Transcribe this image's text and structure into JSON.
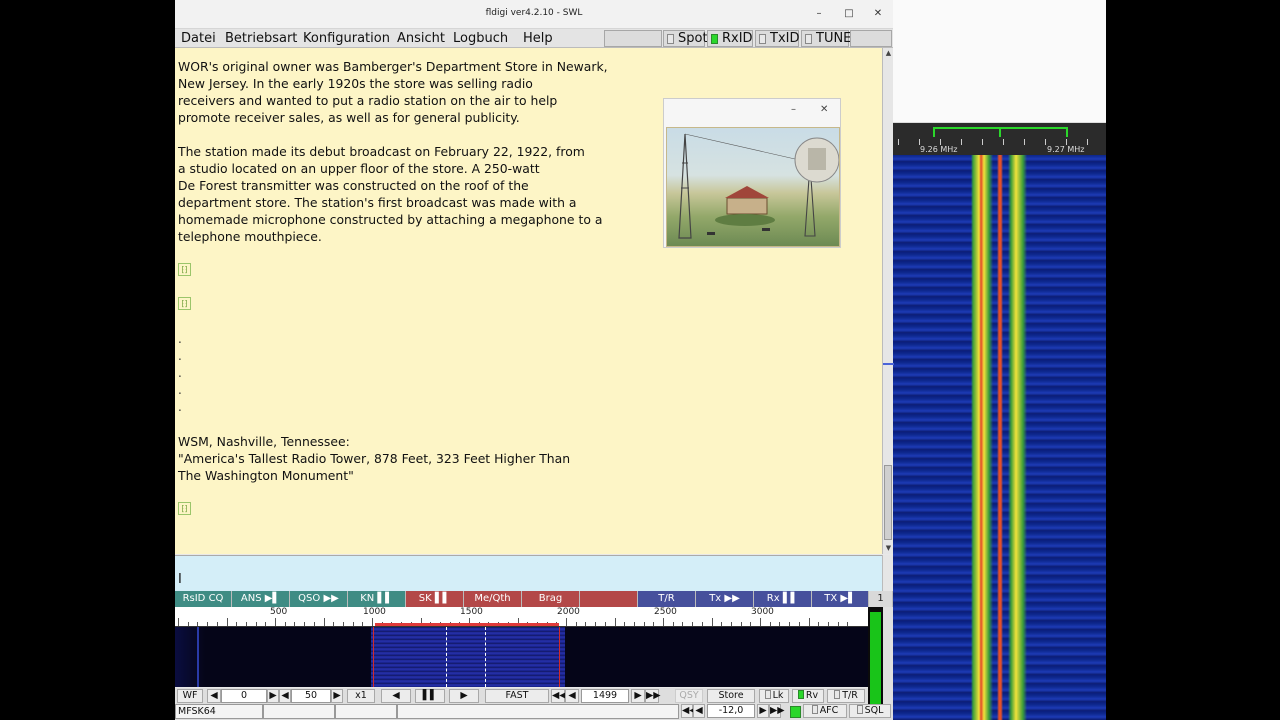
{
  "window": {
    "title": "fldigi ver4.2.10 - SWL",
    "minimize": "–",
    "maximize": "□",
    "close": "✕"
  },
  "menu": {
    "items": [
      "Datei",
      "Betriebsart",
      "Konfiguration",
      "Ansicht",
      "Logbuch",
      "Help"
    ],
    "toggles": [
      {
        "label": "Spot",
        "on": false
      },
      {
        "label": "RxID",
        "on": true
      },
      {
        "label": "TxID",
        "on": false
      },
      {
        "label": "TUNE",
        "on": false
      }
    ]
  },
  "rx_text": {
    "paragraph1": [
      "WOR's original owner was Bamberger's Department Store in Newark,",
      "New Jersey. In the early 1920s the store was selling radio",
      "receivers and wanted to put a radio station on the air to help",
      "promote receiver sales, as well as for general publicity."
    ],
    "paragraph2": [
      "The station made its debut broadcast on February 22, 1922, from",
      "a studio located on an upper floor of the store. A 250-watt",
      "De Forest transmitter was constructed on the roof of the",
      "department store. The station's first broadcast was made with a",
      "homemade microphone constructed by attaching a megaphone to a",
      "telephone mouthpiece."
    ],
    "dots": [
      ".",
      ".",
      ".",
      ".",
      "."
    ],
    "paragraph3": [
      "WSM, Nashville, Tennessee:",
      "\"America's Tallest Radio Tower, 878 Feet, 323 Feet Higher Than",
      "The Washington Monument\""
    ],
    "glyph": "⁅⁆"
  },
  "image_popup": {
    "minimize": "–",
    "close": "✕",
    "caption": "postcard image of radio towers and station building"
  },
  "tx_text": {
    "cursor": "I"
  },
  "macros": [
    {
      "label": "RsID CQ",
      "color": "teal"
    },
    {
      "label": "ANS ▶▌",
      "color": "teal"
    },
    {
      "label": "QSO ▶▶",
      "color": "teal"
    },
    {
      "label": "KN ▌▌",
      "color": "teal"
    },
    {
      "label": "SK ▌▌",
      "color": "red"
    },
    {
      "label": "Me/Qth",
      "color": "red"
    },
    {
      "label": "Brag",
      "color": "red"
    },
    {
      "label": "",
      "color": "red"
    },
    {
      "label": "T/R",
      "color": "blue"
    },
    {
      "label": "Tx ▶▶",
      "color": "blue"
    },
    {
      "label": "Rx ▌▌",
      "color": "blue"
    },
    {
      "label": "TX ▶▌",
      "color": "blue"
    },
    {
      "label": "1",
      "color": "gray"
    }
  ],
  "freq_scale": {
    "labels": [
      "500",
      "1000",
      "1500",
      "2000",
      "2500",
      "3000"
    ]
  },
  "side_waterfall": {
    "labels": [
      "9.26 MHz",
      "9.27 MHz"
    ]
  },
  "controls": {
    "wf_mode": "WF",
    "ref_value": "0",
    "range_value": "50",
    "zoom": "x1",
    "speed": "FAST",
    "carrier_freq": "1499",
    "qsy": "QSY",
    "store": "Store",
    "lk": "Lk",
    "rv": "Rv",
    "tr": "T/R"
  },
  "status": {
    "mode": "MFSK64",
    "s2n": "",
    "imd": "",
    "msg": "",
    "squelch_value": "-12,0",
    "afc": "AFC",
    "sql": "SQL"
  },
  "colors": {
    "rx_bg": "#fdf5c6",
    "tx_bg": "#d4eef8",
    "macro_teal": "#3f8c84",
    "macro_red": "#b34848",
    "macro_blue": "#46509c"
  }
}
